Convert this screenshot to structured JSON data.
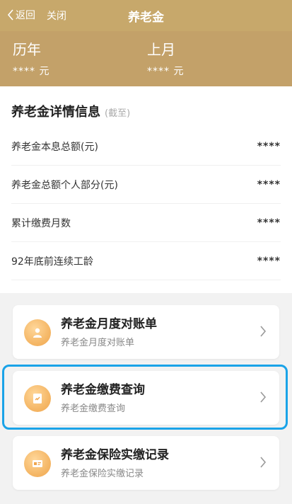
{
  "header": {
    "back_label": "返回",
    "close_label": "关闭",
    "title": "养老金"
  },
  "summary": {
    "left": {
      "label": "历年",
      "value": "**** 元"
    },
    "right": {
      "label": "上月",
      "value": "**** 元"
    }
  },
  "detail": {
    "title": "养老金详情信息",
    "subtitle": "(截至)",
    "rows": [
      {
        "label": "养老金本息总额(元)",
        "value": "****"
      },
      {
        "label": "养老金总额个人部分(元)",
        "value": "****"
      },
      {
        "label": "累计缴费月数",
        "value": "****"
      },
      {
        "label": "92年底前连续工龄",
        "value": "****"
      }
    ]
  },
  "entries": [
    {
      "title": "养老金月度对账单",
      "subtitle": "养老金月度对账单",
      "icon": "person-icon"
    },
    {
      "title": "养老金缴费查询",
      "subtitle": "养老金缴费查询",
      "icon": "document-icon"
    },
    {
      "title": "养老金保险实缴记录",
      "subtitle": "养老金保险实缴记录",
      "icon": "card-icon"
    }
  ],
  "colors": {
    "header_gold": "#c7a86b",
    "summary_gold": "#c3a169",
    "icon_orange": "#f5b868",
    "highlight_blue": "#1aa3e8"
  }
}
